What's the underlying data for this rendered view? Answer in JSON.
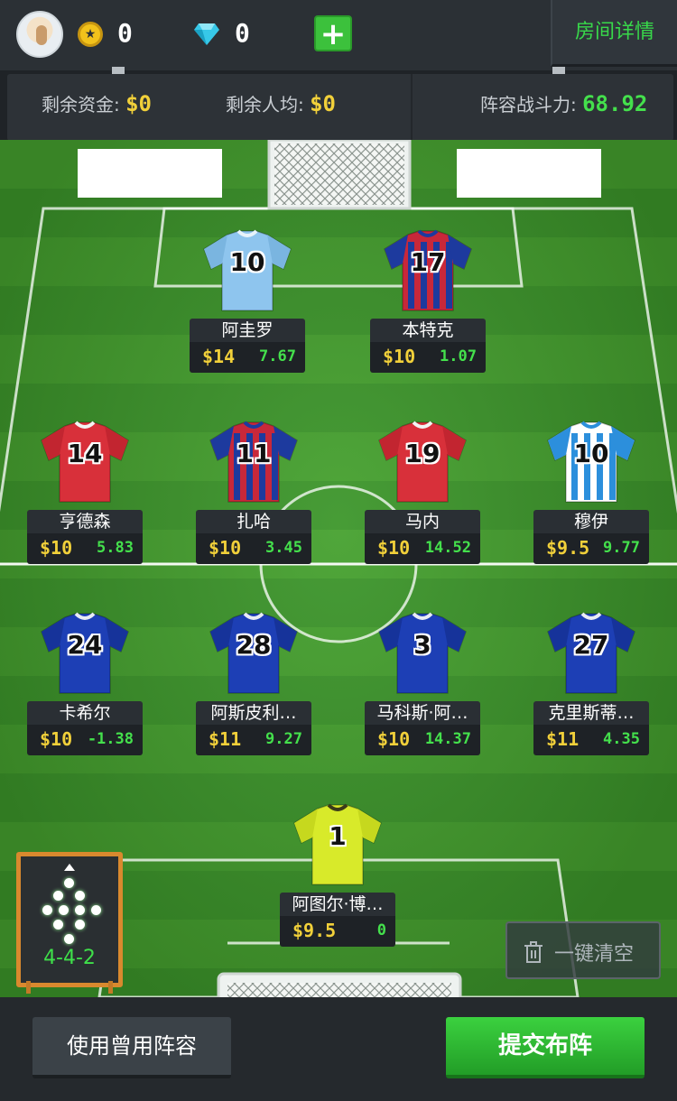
{
  "header": {
    "coins": "0",
    "gems": "0",
    "add_label": "+",
    "room_details_label": "房间详情"
  },
  "stats": {
    "remaining_funds_label": "剩余资金: ",
    "remaining_funds_value": "$0",
    "remaining_avg_label": "剩余人均: ",
    "remaining_avg_value": "$0",
    "lineup_power_label": "阵容战斗力: ",
    "lineup_power_value": "68.92"
  },
  "colors": {
    "accent_green": "#44e04c",
    "price_yellow": "#f1d03a",
    "formation_orange": "#d9892e"
  },
  "players": [
    {
      "name": "阿圭罗",
      "number": "10",
      "price": "$14",
      "score": "7.67",
      "kit": "sky"
    },
    {
      "name": "本特克",
      "number": "17",
      "price": "$10",
      "score": "1.07",
      "kit": "stripes"
    },
    {
      "name": "亨德森",
      "number": "14",
      "price": "$10",
      "score": "5.83",
      "kit": "red"
    },
    {
      "name": "扎哈",
      "number": "11",
      "price": "$10",
      "score": "3.45",
      "kit": "stripes"
    },
    {
      "name": "马内",
      "number": "19",
      "price": "$10",
      "score": "14.52",
      "kit": "red"
    },
    {
      "name": "穆伊",
      "number": "10",
      "price": "$9.5",
      "score": "9.77",
      "kit": "hoops"
    },
    {
      "name": "卡希尔",
      "number": "24",
      "price": "$10",
      "score": "-1.38",
      "kit": "blue"
    },
    {
      "name": "阿斯皮利…",
      "number": "28",
      "price": "$11",
      "score": "9.27",
      "kit": "blue"
    },
    {
      "name": "马科斯·阿…",
      "number": "3",
      "price": "$10",
      "score": "14.37",
      "kit": "blue"
    },
    {
      "name": "克里斯蒂…",
      "number": "27",
      "price": "$11",
      "score": "4.35",
      "kit": "blue"
    },
    {
      "name": "阿图尔·博…",
      "number": "1",
      "price": "$9.5",
      "score": "0",
      "kit": "keeper"
    }
  ],
  "formation": {
    "label": "4-4-2"
  },
  "actions": {
    "clear_label": "一键清空",
    "used_lineup_label": "使用曾用阵容",
    "submit_label": "提交布阵"
  }
}
